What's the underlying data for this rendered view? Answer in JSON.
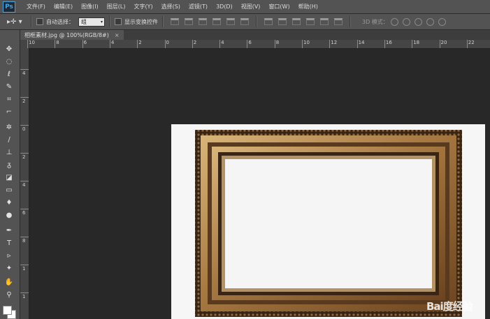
{
  "app": {
    "logo": "Ps"
  },
  "menu": [
    "文件(F)",
    "编辑(E)",
    "图像(I)",
    "图层(L)",
    "文字(Y)",
    "选择(S)",
    "滤镜(T)",
    "3D(D)",
    "视图(V)",
    "窗口(W)",
    "帮助(H)"
  ],
  "options": {
    "tool_glyph": "▸✛ ▾",
    "auto_select_label": "自动选择：",
    "auto_select_value": "组",
    "show_transform_label": "显示变换控件",
    "mode_3d_label": "3D 模式："
  },
  "document": {
    "tab_label": "相框素材.jpg @ 100%(RGB/8#)",
    "close_glyph": "×"
  },
  "ruler_h_labels": [
    "10",
    "8",
    "6",
    "4",
    "2",
    "0",
    "2",
    "4",
    "6",
    "8",
    "10",
    "12",
    "14",
    "16",
    "18",
    "20",
    "22"
  ],
  "ruler_v_labels": [
    "4",
    "2",
    "0",
    "2",
    "4",
    "6",
    "8",
    "1",
    "1"
  ],
  "watermark": "Bai度经验"
}
